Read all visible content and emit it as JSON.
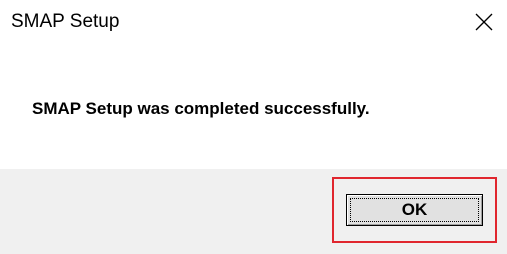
{
  "window": {
    "title": "SMAP Setup",
    "close_icon": "close-icon"
  },
  "message": {
    "text": "SMAP Setup was completed successfully."
  },
  "buttons": {
    "ok_label": "OK"
  },
  "colors": {
    "highlight": "#e0262e",
    "button_bar": "#f0f0f0"
  }
}
